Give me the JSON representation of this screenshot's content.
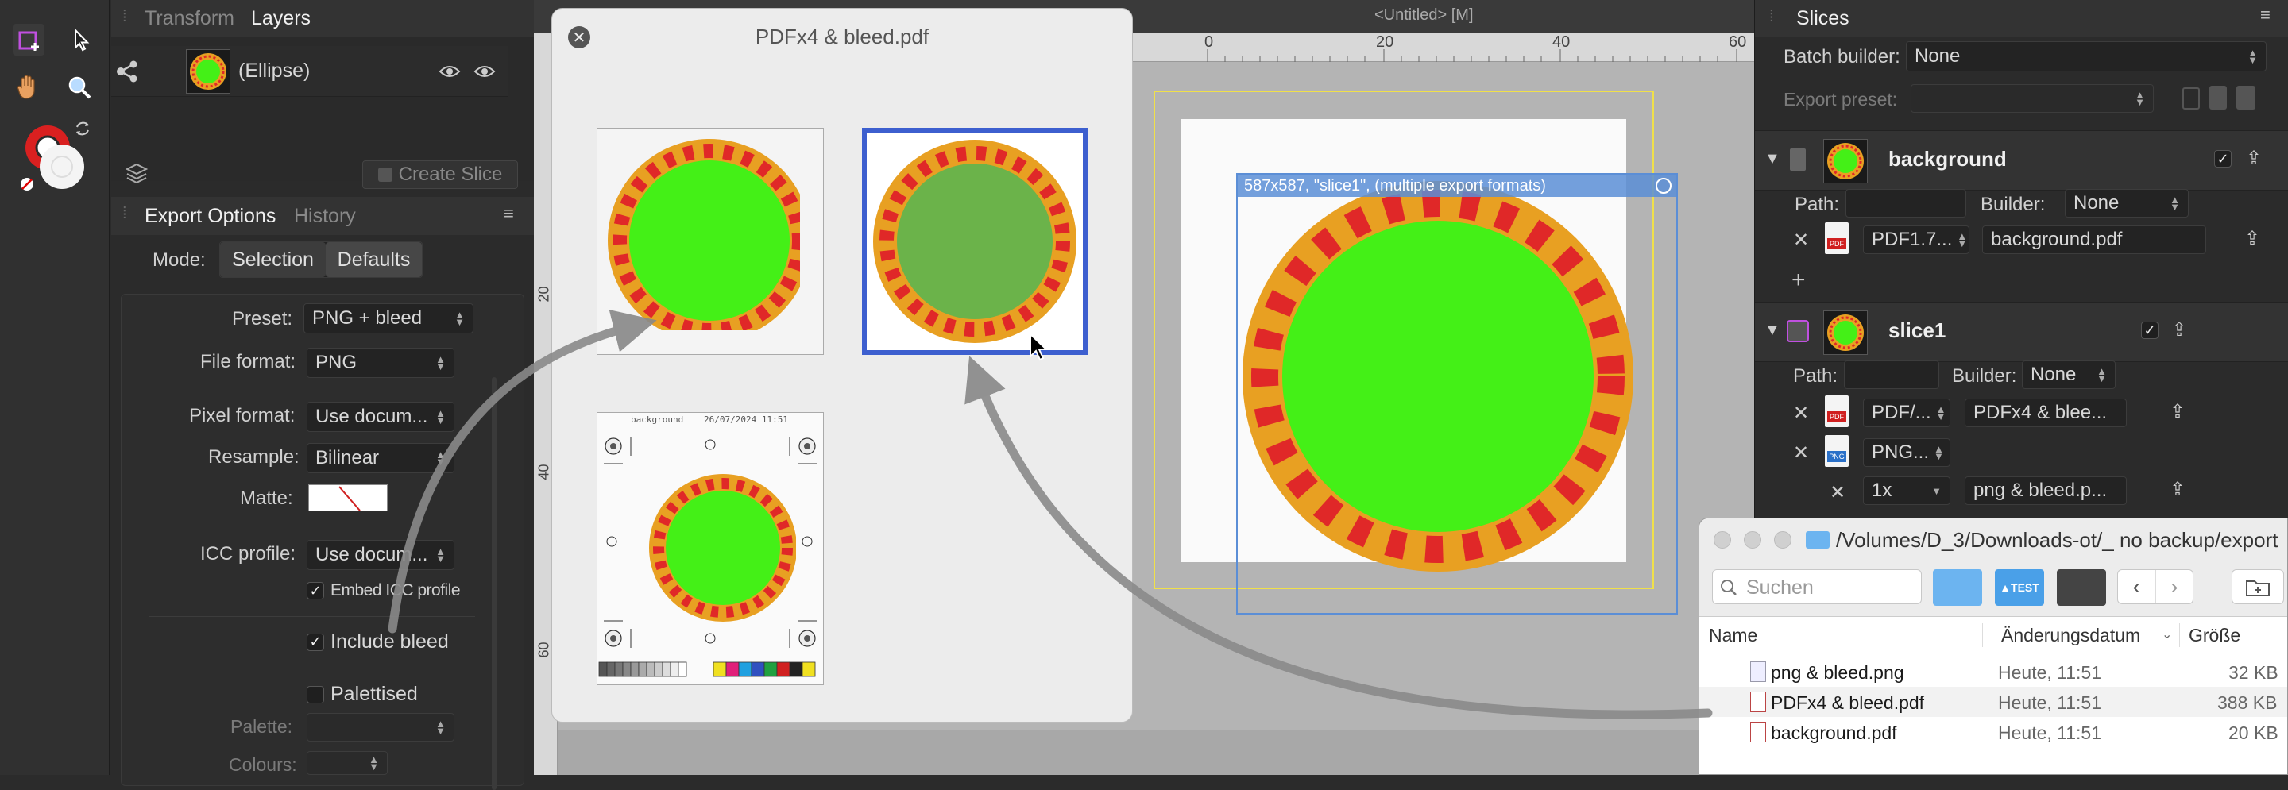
{
  "colors": {
    "accent": "#3d5fcf",
    "orange": "#e8a022",
    "green": "#44f017",
    "red": "#e02828",
    "selection": "#5b8ed6"
  },
  "tools": {
    "icons": [
      "artboard-tool-icon",
      "move-tool-icon",
      "share-icon",
      "hand-tool-icon",
      "zoom-tool-icon",
      "color-wheel-icon",
      "swap-colors-icon"
    ]
  },
  "layers_panel": {
    "tabs": [
      "Transform",
      "Layers"
    ],
    "layer_name": "(Ellipse)",
    "create_slice": "Create Slice"
  },
  "export_options": {
    "tabs": [
      "Export Options",
      "History"
    ],
    "mode_label": "Mode:",
    "mode_options": [
      "Selection",
      "Defaults"
    ],
    "preset_label": "Preset:",
    "preset_value": "PNG + bleed",
    "file_format_label": "File format:",
    "file_format_value": "PNG",
    "pixel_format_label": "Pixel format:",
    "pixel_format_value": "Use docum...",
    "resample_label": "Resample:",
    "resample_value": "Bilinear",
    "matte_label": "Matte:",
    "icc_label": "ICC profile:",
    "icc_value": "Use docum...",
    "embed_icc": "Embed ICC profile",
    "include_bleed": "Include bleed",
    "palettised": "Palettised",
    "palette_label": "Palette:",
    "colours_label": "Colours:"
  },
  "preview": {
    "title": "PDFx4 & bleed.pdf",
    "page_header_name": "background",
    "page_header_date": "26/07/2024 11:51"
  },
  "canvas": {
    "doc_title": "<Untitled> [M]",
    "ruler_labels": [
      "0",
      "20",
      "40",
      "60"
    ],
    "vruler_labels": [
      "20",
      "40",
      "60"
    ],
    "slice_label": "587x587, \"slice1\", (multiple export formats)"
  },
  "slices": {
    "title": "Slices",
    "batch_label": "Batch builder:",
    "batch_value": "None",
    "export_preset_label": "Export preset:",
    "background": {
      "name": "background",
      "path_label": "Path:",
      "builder_label": "Builder:",
      "builder_value": "None",
      "format": "PDF1.7...",
      "filename": "background.pdf"
    },
    "slice1": {
      "name": "slice1",
      "path_label": "Path:",
      "builder_label": "Builder:",
      "builder_value": "None",
      "format1": "PDF/...",
      "filename1": "PDFx4 & blee...",
      "format2": "PNG...",
      "scale": "1x",
      "filename2": "png & bleed.p..."
    }
  },
  "finder": {
    "path": "/Volumes/D_3/Downloads-ot/_ no backup/export",
    "search_placeholder": "Suchen",
    "columns": [
      "Name",
      "Änderungsdatum",
      "Größe"
    ],
    "files": [
      {
        "name": "png & bleed.png",
        "date": "Heute, 11:51",
        "size": "32 KB"
      },
      {
        "name": "PDFx4 & bleed.pdf",
        "date": "Heute, 11:51",
        "size": "388 KB"
      },
      {
        "name": "background.pdf",
        "date": "Heute, 11:51",
        "size": "20 KB"
      }
    ]
  }
}
